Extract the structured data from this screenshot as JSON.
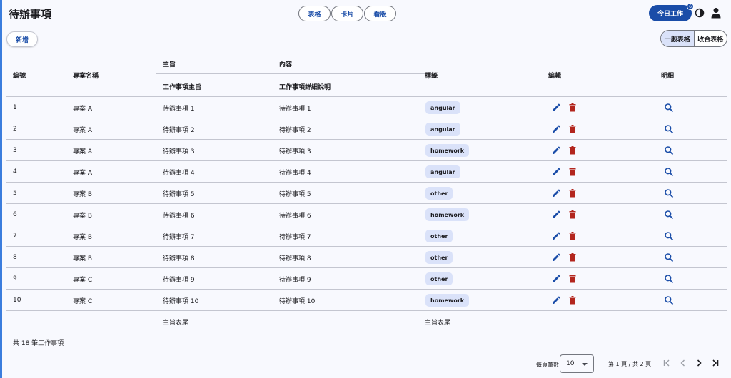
{
  "header": {
    "title": "待辦事項",
    "view_tabs": [
      "表格",
      "卡片",
      "看版"
    ],
    "today_button": "今日工作",
    "badge_count": "6"
  },
  "toolbar": {
    "add_label": "新增",
    "table_modes": [
      "一般表格",
      "收合表格"
    ]
  },
  "table": {
    "headers": {
      "id": "編號",
      "project": "專案名稱",
      "group_subject": "主旨",
      "group_content": "內容",
      "subject": "工作事項主旨",
      "detail": "工作事項詳細說明",
      "tag": "標籤",
      "edit": "編輯",
      "view": "明細"
    },
    "rows": [
      {
        "id": "1",
        "project": "專案 A",
        "subject": "待辦事項 1",
        "detail": "待辦事項 1",
        "tag": "angular"
      },
      {
        "id": "2",
        "project": "專案 A",
        "subject": "待辦事項 2",
        "detail": "待辦事項 2",
        "tag": "angular"
      },
      {
        "id": "3",
        "project": "專案 A",
        "subject": "待辦事項 3",
        "detail": "待辦事項 3",
        "tag": "homework"
      },
      {
        "id": "4",
        "project": "專案 A",
        "subject": "待辦事項 4",
        "detail": "待辦事項 4",
        "tag": "angular"
      },
      {
        "id": "5",
        "project": "專案 B",
        "subject": "待辦事項 5",
        "detail": "待辦事項 5",
        "tag": "other"
      },
      {
        "id": "6",
        "project": "專案 B",
        "subject": "待辦事項 6",
        "detail": "待辦事項 6",
        "tag": "homework"
      },
      {
        "id": "7",
        "project": "專案 B",
        "subject": "待辦事項 7",
        "detail": "待辦事項 7",
        "tag": "other"
      },
      {
        "id": "8",
        "project": "專案 B",
        "subject": "待辦事項 8",
        "detail": "待辦事項 8",
        "tag": "other"
      },
      {
        "id": "9",
        "project": "專案 C",
        "subject": "待辦事項 9",
        "detail": "待辦事項 9",
        "tag": "other"
      },
      {
        "id": "10",
        "project": "專案 C",
        "subject": "待辦事項 10",
        "detail": "待辦事項 10",
        "tag": "homework"
      }
    ],
    "footer": {
      "subject": "主旨表尾",
      "tag": "主旨表尾"
    }
  },
  "summary": {
    "total": "共 18 筆工作事項"
  },
  "paginator": {
    "per_page_label": "每頁筆數",
    "per_page_value": "10",
    "range_label": "第 1 頁 / 共 2 頁"
  },
  "icons": {
    "edit": "pencil-icon",
    "delete": "trash-icon",
    "view": "search-icon",
    "theme": "contrast-icon",
    "user": "person-icon",
    "first_page": "first-page-icon",
    "prev_page": "chevron-left-icon",
    "next_page": "chevron-right-icon",
    "last_page": "last-page-icon"
  },
  "colors": {
    "primary": "#1a4da8",
    "chip": "#dae2f9",
    "delete": "#b3261e",
    "accent_strip": "#3b7ddd"
  }
}
